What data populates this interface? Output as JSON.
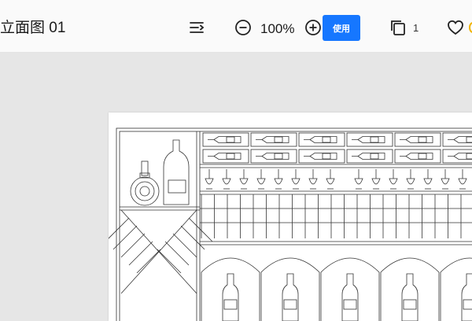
{
  "document": {
    "title": "立面图 01"
  },
  "toolbar": {
    "outline_icon": "outline-list-icon",
    "zoom_out_icon": "zoom-out-icon",
    "zoom_level": "100%",
    "zoom_in_icon": "zoom-in-icon",
    "use_button_label": "使用",
    "use_button_color": "#1677ff",
    "pages_icon": "pages-copy-icon",
    "page_count": "1",
    "favorite_icon": "heart-icon"
  }
}
